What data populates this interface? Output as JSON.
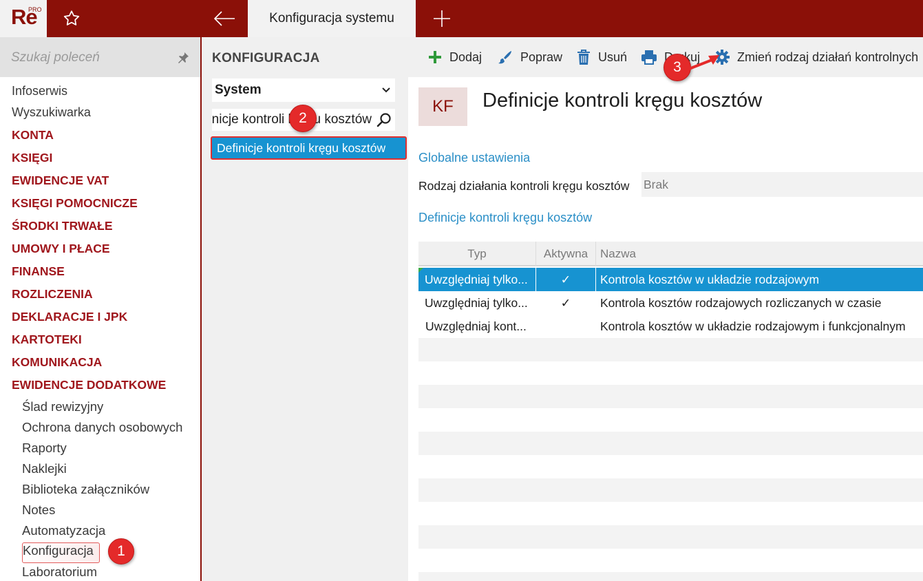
{
  "app": {
    "logo_text": "Re",
    "logo_badge": "PRO",
    "active_tab": "Konfiguracja systemu",
    "colors": {
      "brand": "#8b1008",
      "accent_blue": "#1793d1",
      "section_red": "#a0171d",
      "callout_red": "#e42a2a"
    }
  },
  "leftnav": {
    "search_placeholder": "Szukaj poleceń",
    "items": [
      "Infoserwis",
      "Wyszukiwarka"
    ],
    "sections": [
      "KONTA",
      "KSIĘGI",
      "EWIDENCJE VAT",
      "KSIĘGI POMOCNICZE",
      "ŚRODKI TRWAŁE",
      "UMOWY I PŁACE",
      "FINANSE",
      "ROZLICZENIA",
      "DEKLARACJE I JPK",
      "KARTOTEKI",
      "KOMUNIKACJA",
      "EWIDENCJE DODATKOWE"
    ],
    "subitems": [
      "Ślad rewizyjny",
      "Ochrona danych osobowych",
      "Raporty",
      "Naklejki",
      "Biblioteka załączników",
      "Notes",
      "Automatyzacja",
      "Konfiguracja",
      "Laboratorium"
    ],
    "selected": "Konfiguracja"
  },
  "midcol": {
    "title": "KONFIGURACJA",
    "select_value": "System",
    "filter_value": "Definicje kontroli kręgu kosztów",
    "selected_item": "Definicje kontroli kręgu kosztów"
  },
  "toolbar": {
    "add": "Dodaj",
    "edit": "Popraw",
    "delete": "Usuń",
    "print": "Drukuj",
    "change": "Zmień rodzaj działań kontrolnych"
  },
  "main": {
    "badge": "KF",
    "title": "Definicje kontroli kręgu kosztów",
    "global_section": "Globalne ustawienia",
    "field_label": "Rodzaj działania kontroli kręgu kosztów",
    "field_value": "Brak",
    "definitions_section": "Definicje kontroli kręgu kosztów"
  },
  "grid": {
    "columns": [
      "Typ",
      "Aktywna",
      "Nazwa"
    ],
    "rows": [
      {
        "typ": "Uwzględniaj tylko...",
        "aktywna": "✓",
        "nazwa": "Kontrola kosztów w układzie rodzajowym"
      },
      {
        "typ": "Uwzględniaj tylko...",
        "aktywna": "✓",
        "nazwa": "Kontrola kosztów rodzajowych rozliczanych w czasie"
      },
      {
        "typ": "Uwzględniaj kont...",
        "aktywna": "",
        "nazwa": "Kontrola kosztów w układzie rodzajowym i funkcjonalnym"
      }
    ],
    "selected_row": 0
  },
  "callouts": [
    "1",
    "2",
    "3"
  ]
}
